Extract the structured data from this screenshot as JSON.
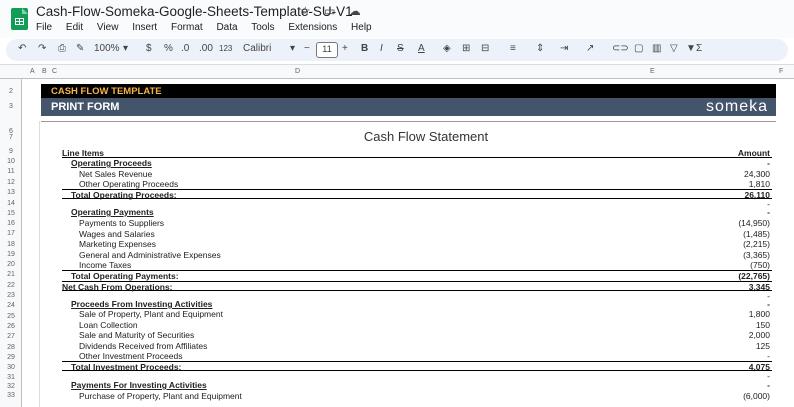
{
  "doc_title": "Cash-Flow-Someka-Google-Sheets-Template-SU-V1",
  "title_icons": [
    "star-icon",
    "folder-move-icon",
    "cloud-status-icon"
  ],
  "menus": [
    "File",
    "Edit",
    "View",
    "Insert",
    "Format",
    "Data",
    "Tools",
    "Extensions",
    "Help"
  ],
  "toolbar": {
    "zoom": "100%",
    "currency": "$",
    "percent": "%",
    "dec_less": ".0",
    "dec_more": ".00",
    "number_format": "123",
    "font": "Calibri",
    "font_size": "11"
  },
  "columns": [
    "A",
    "B",
    "C",
    "D",
    "E",
    "F"
  ],
  "row_numbers": [
    "2",
    "3",
    "6",
    "7",
    "9",
    "10",
    "11",
    "12",
    "13",
    "14",
    "15",
    "16",
    "17",
    "18",
    "19",
    "20",
    "21",
    "22",
    "23",
    "24",
    "25",
    "26",
    "27",
    "28",
    "29",
    "30",
    "31",
    "32",
    "33"
  ],
  "banner": {
    "template": "CASH FLOW TEMPLATE",
    "print_form": "PRINT FORM",
    "brand": "someka"
  },
  "colors": {
    "banner_black": "#000000",
    "banner_template_text": "#f5b54a",
    "print_band": "#44546a",
    "logo_green": "#0f9d58"
  },
  "sheet_title": "Cash Flow Statement",
  "header": {
    "label": "Line Items",
    "amount": "Amount"
  },
  "lines": [
    {
      "label": "Operating Proceeds",
      "value": "-"
    },
    {
      "label": "Net Sales Revenue",
      "value": "24,300"
    },
    {
      "label": "Other Operating Proceeds",
      "value": "1,810"
    },
    {
      "label": "Total Operating Proceeds:",
      "value": "26,110"
    },
    {
      "label": "",
      "value": "-"
    },
    {
      "label": "Operating Payments",
      "value": "-"
    },
    {
      "label": "Payments to Suppliers",
      "value": "(14,950)"
    },
    {
      "label": "Wages and Salaries",
      "value": "(1,485)"
    },
    {
      "label": "Marketing Expenses",
      "value": "(2,215)"
    },
    {
      "label": "General and Administrative Expenses",
      "value": "(3,365)"
    },
    {
      "label": "Income Taxes",
      "value": "(750)"
    },
    {
      "label": "Total Operating Payments:",
      "value": "(22,765)"
    },
    {
      "label": "Net Cash From Operations:",
      "value": "3,345"
    },
    {
      "label": "",
      "value": "-"
    },
    {
      "label": "Proceeds From Investing Activities",
      "value": "-"
    },
    {
      "label": "Sale of Property, Plant and Equipment",
      "value": "1,800"
    },
    {
      "label": "Loan Collection",
      "value": "150"
    },
    {
      "label": "Sale and Maturity of Securities",
      "value": "2,000"
    },
    {
      "label": "Dividends Received from Affiliates",
      "value": "125"
    },
    {
      "label": "Other Investment Proceeds",
      "value": "-"
    },
    {
      "label": "Total Investment Proceeds:",
      "value": "4,075"
    },
    {
      "label": "",
      "value": "-"
    },
    {
      "label": "Payments For Investing Activities",
      "value": "-"
    },
    {
      "label": "Purchase of Property, Plant and Equipment",
      "value": "(6,000)"
    }
  ]
}
